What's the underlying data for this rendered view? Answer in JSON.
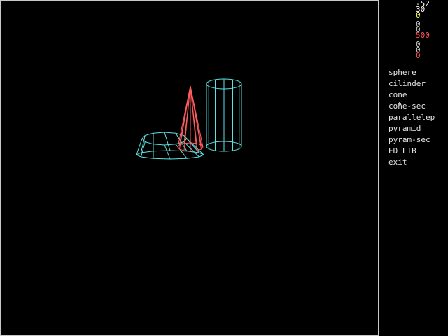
{
  "params": [
    {
      "value": "-52",
      "color": "#ffffff"
    },
    {
      "value": "30",
      "color": "#ffffff"
    },
    {
      "value": "0",
      "color": "#ffff66"
    },
    {
      "value": "0",
      "color": "#cccccc"
    },
    {
      "value": "0",
      "color": "#cccccc"
    },
    {
      "value": "500",
      "color": "#ff5555"
    },
    {
      "value": "0",
      "color": "#cccccc"
    },
    {
      "value": "0",
      "color": "#cccccc"
    },
    {
      "value": "0",
      "color": "#ff5555"
    }
  ],
  "menu": {
    "items": [
      {
        "label": "sphere"
      },
      {
        "label": "cilinder"
      },
      {
        "label": "cone"
      },
      {
        "label": "cone-sec"
      },
      {
        "label": "parallelep"
      },
      {
        "label": "pyramid"
      },
      {
        "label": "pyram-sec"
      },
      {
        "label": "ED LIB"
      },
      {
        "label": "exit"
      }
    ]
  },
  "scene": {
    "objects": [
      {
        "type": "cone-sec",
        "color": "#5fe0e0"
      },
      {
        "type": "cone",
        "color": "#ff5c5c"
      },
      {
        "type": "cilinder",
        "color": "#5fe0e0"
      }
    ]
  }
}
